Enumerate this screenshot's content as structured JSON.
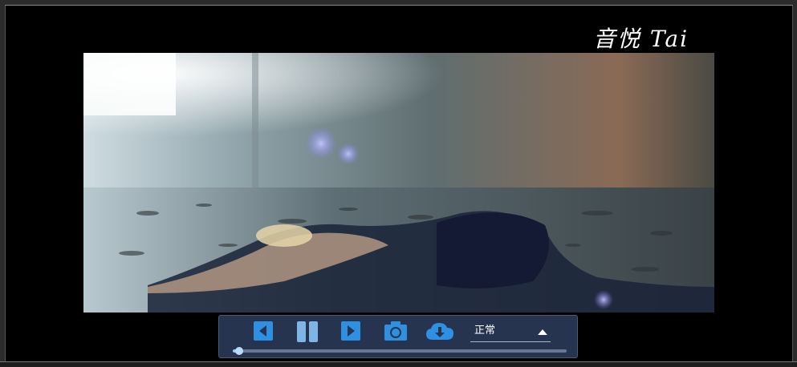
{
  "watermark": {
    "text": "音悦 Tai"
  },
  "player": {
    "controls": {
      "prev_icon": "skip-back-icon",
      "pause_icon": "pause-icon",
      "next_icon": "skip-forward-icon",
      "screenshot_icon": "camera-icon",
      "download_icon": "cloud-download-icon",
      "speed": {
        "selected": "正常",
        "caret_icon": "caret-up-icon"
      }
    },
    "progress": {
      "value": 0.02
    },
    "colors": {
      "accent": "#2f8fe0",
      "panel": "#263450",
      "track": "#6a7590"
    }
  }
}
